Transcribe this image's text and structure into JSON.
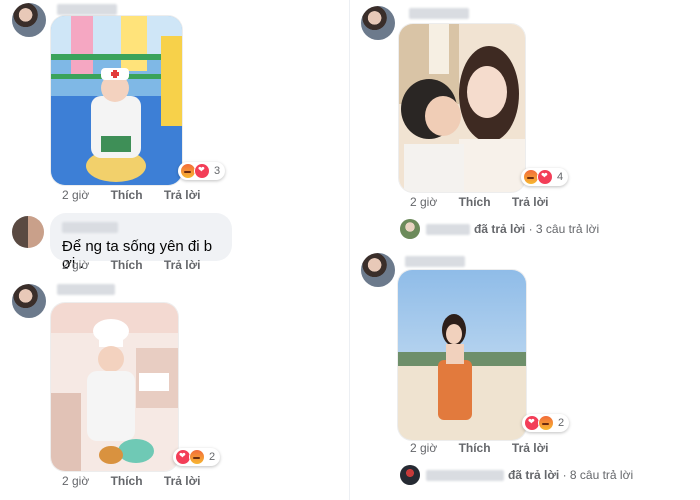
{
  "left": {
    "c1": {
      "actions": {
        "time": "2 giờ",
        "like": "Thích",
        "reply": "Trả lời"
      },
      "reactions": {
        "icons": [
          "angry-icon",
          "love-icon"
        ],
        "count": "3"
      }
    },
    "c2": {
      "text": "Để ng ta sống yên đi b ơi .",
      "actions": {
        "time": "2 giờ",
        "like": "Thích",
        "reply": "Trả lời"
      }
    },
    "c3": {
      "actions": {
        "time": "2 giờ",
        "like": "Thích",
        "reply": "Trả lời"
      },
      "reactions": {
        "icons": [
          "love-icon",
          "angry-icon"
        ],
        "count": "2"
      }
    }
  },
  "right": {
    "c1": {
      "actions": {
        "time": "2 giờ",
        "like": "Thích",
        "reply": "Trả lời"
      },
      "reactions": {
        "icons": [
          "angry-icon",
          "love-icon"
        ],
        "count": "4"
      },
      "reply_summary": {
        "action": "đã trả lời",
        "count_text": "· 3 câu trả lời"
      }
    },
    "c2": {
      "actions": {
        "time": "2 giờ",
        "like": "Thích",
        "reply": "Trả lời"
      },
      "reactions": {
        "icons": [
          "love-icon",
          "angry-icon"
        ],
        "count": "2"
      },
      "reply_summary": {
        "action": "đã trả lời",
        "count_text": "· 8 câu trả lời"
      }
    }
  },
  "colors": {
    "secondary_text": "#65676b",
    "bubble_bg": "#f0f2f5",
    "love": "#f33e58",
    "angry": "#f26b3a"
  }
}
